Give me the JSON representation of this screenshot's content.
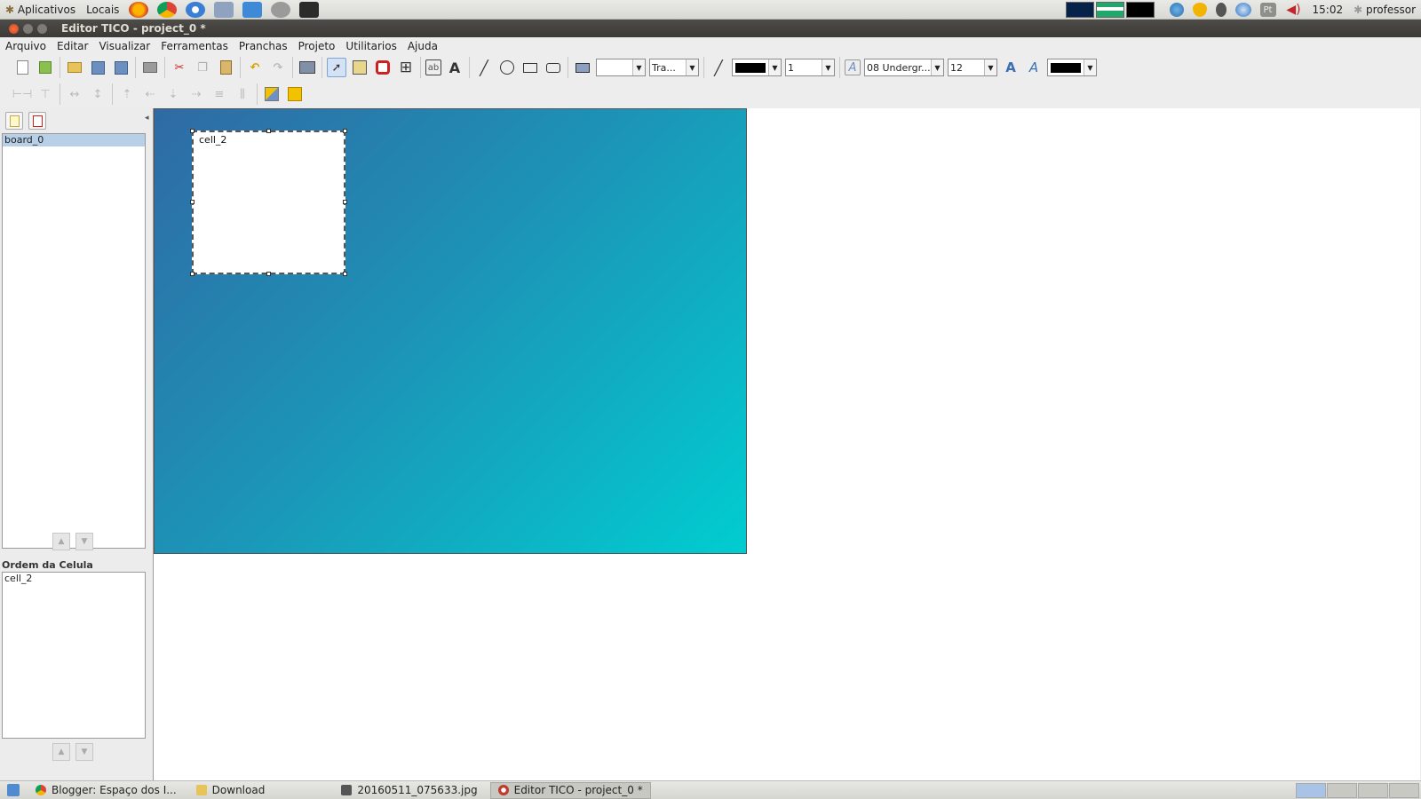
{
  "topbar": {
    "apps_label": "Aplicativos",
    "places_label": "Locais",
    "clock": "15:02",
    "user": "professor",
    "keyboard_layout": "Pt",
    "launcher_icons": [
      "firefox-icon",
      "chrome-icon",
      "chromium-icon",
      "settings-app-icon",
      "mail-icon",
      "draw-app-icon",
      "terminal-icon"
    ]
  },
  "window": {
    "title": "Editor TICO - project_0 *"
  },
  "menu": [
    "Arquivo",
    "Editar",
    "Visualizar",
    "Ferramentas",
    "Pranchas",
    "Projeto",
    "Utilitarios",
    "Ajuda"
  ],
  "toolbar": {
    "fill_combo": "",
    "transparency_combo": "Tra...",
    "line_width_combo": "1",
    "font_combo": "08 Undergr...",
    "font_size_combo": "12"
  },
  "left_panel": {
    "boards": [
      "board_0"
    ],
    "cell_order_title": "Ordem da Celula",
    "cells": [
      "cell_2"
    ]
  },
  "canvas": {
    "cell_label": "cell_2"
  },
  "taskbar": [
    {
      "label": "Blogger: Espaço dos I..."
    },
    {
      "label": "Download"
    },
    {
      "label": "20160511_075633.jpg"
    },
    {
      "label": "Editor TICO - project_0 *"
    }
  ],
  "colors": {
    "board_gradient_start": "#2f6aa5",
    "board_gradient_end": "#00cdd0",
    "selection": "#b8cfe8",
    "titlebar": "#3c3b37"
  }
}
